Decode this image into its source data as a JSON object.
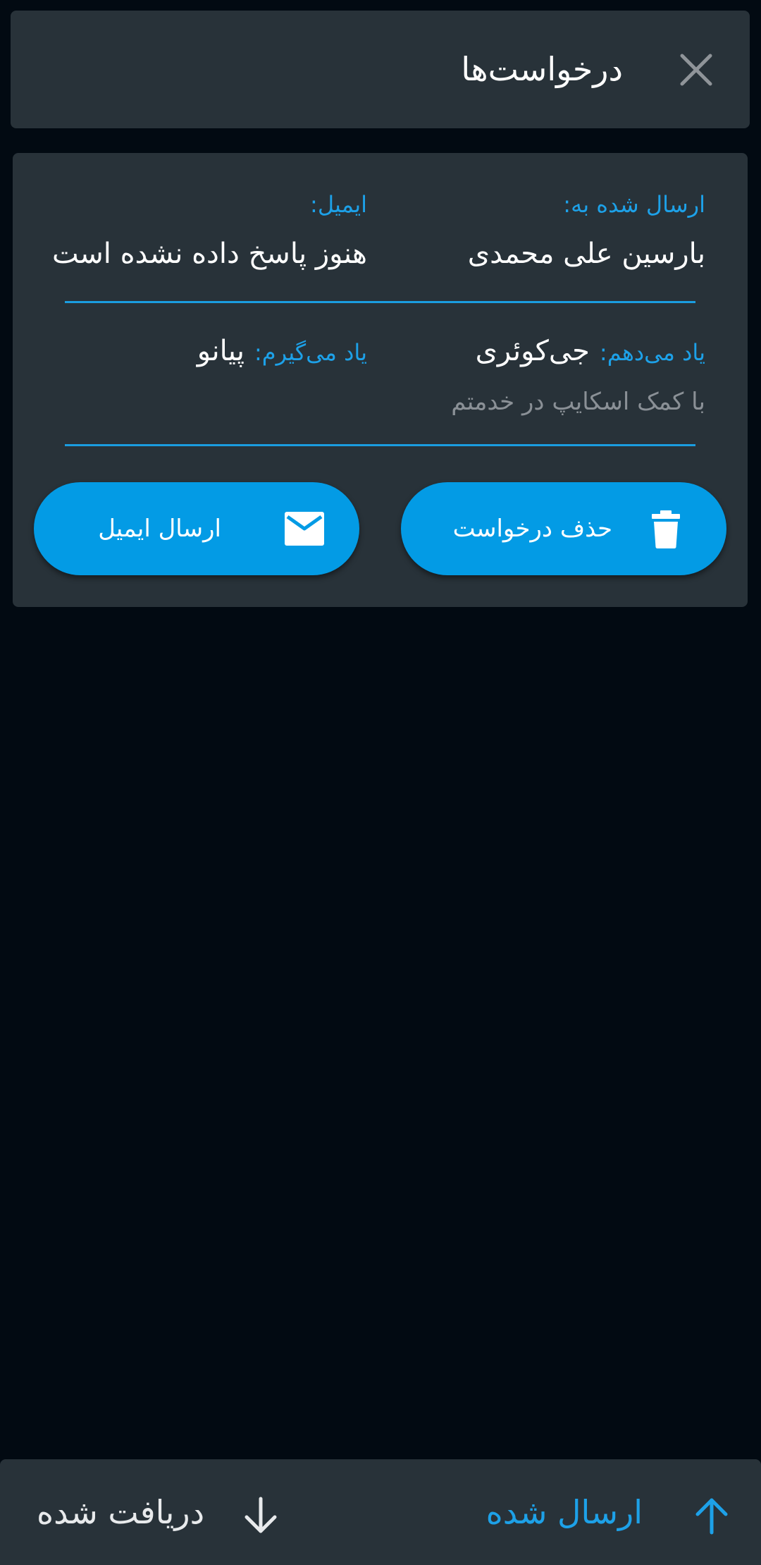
{
  "colors": {
    "background": "#020a12",
    "surface": "#283239",
    "accent": "#039be5",
    "accent_text": "#1da1e8",
    "muted_text": "#8a9096"
  },
  "header": {
    "title": "درخواست‌ها",
    "close_icon": "close-icon"
  },
  "request": {
    "sent_to_label": "ارسال شده به:",
    "sent_to_value": "بارسین علی محمدی",
    "email_label": "ایمیل:",
    "email_value": "هنوز پاسخ داده نشده است",
    "teach_label": "یاد می‌دهم:",
    "teach_value": "جی‌کوئری",
    "learn_label": "یاد می‌گیرم:",
    "learn_value": "پیانو",
    "note": "با کمک اسکایپ در خدمتم",
    "delete_button_label": "حذف درخواست",
    "delete_icon": "trash-icon",
    "email_button_label": "ارسال ایمیل",
    "email_icon": "mail-icon"
  },
  "bottom_nav": {
    "sent_label": "ارسال شده",
    "sent_icon": "arrow-up-icon",
    "received_label": "دریافت شده",
    "received_icon": "arrow-down-icon"
  }
}
